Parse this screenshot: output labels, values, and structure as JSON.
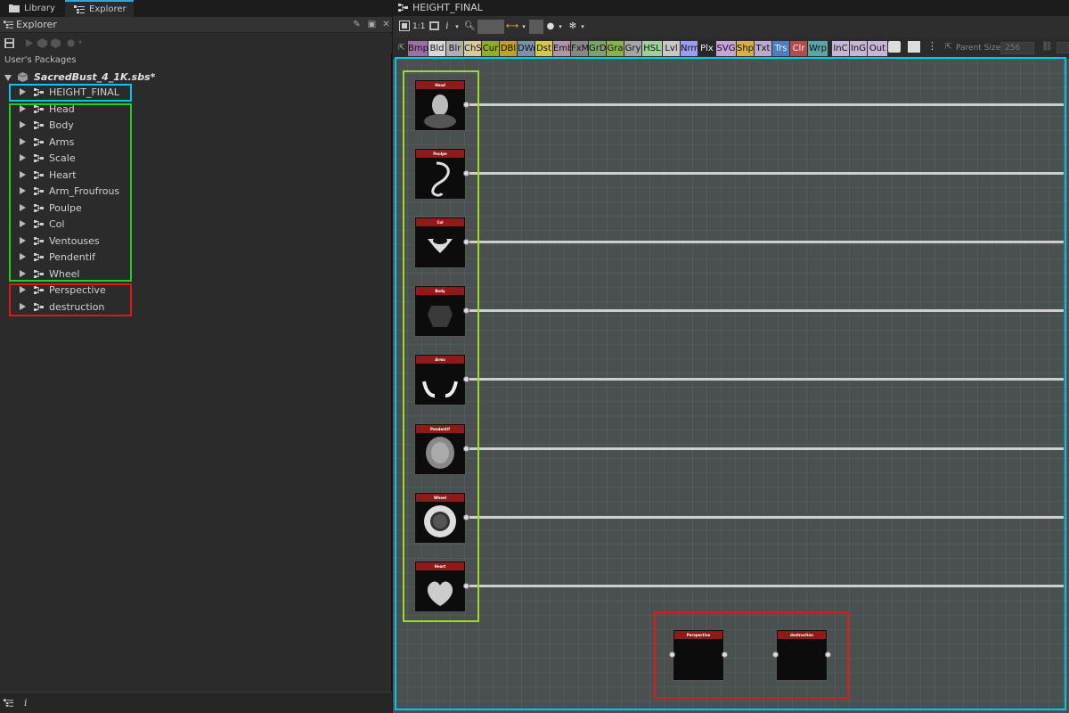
{
  "tabs": [
    {
      "label": "Library"
    },
    {
      "label": "Explorer"
    }
  ],
  "explorer": {
    "title": "Explorer",
    "section_label": "User's Packages",
    "package": "SacredBust_4_1K.sbs*",
    "graphs": [
      {
        "label": "HEIGHT_FINAL"
      },
      {
        "label": "Head"
      },
      {
        "label": "Body"
      },
      {
        "label": "Arms"
      },
      {
        "label": "Scale"
      },
      {
        "label": "Heart"
      },
      {
        "label": "Arm_Froufrous"
      },
      {
        "label": "Poulpe"
      },
      {
        "label": "Col"
      },
      {
        "label": "Ventouses"
      },
      {
        "label": "Pendentif"
      },
      {
        "label": "Wheel"
      },
      {
        "label": "Perspective"
      },
      {
        "label": "destruction"
      }
    ],
    "footer_info": "i"
  },
  "graph_view": {
    "title": "HEIGHT_FINAL",
    "zoom_label": "1:1",
    "info_label": "i",
    "node_buttons": [
      {
        "label": "Bmp",
        "color": "#9c6fa6"
      },
      {
        "label": "Bld",
        "color": "#d9d9d9"
      },
      {
        "label": "Blr",
        "color": "#b0b0b0"
      },
      {
        "label": "ChS",
        "color": "#d7c9a0"
      },
      {
        "label": "Cur",
        "color": "#8fae2a"
      },
      {
        "label": "DBl",
        "color": "#c1a12b"
      },
      {
        "label": "DWr",
        "color": "#7893a9"
      },
      {
        "label": "Dst",
        "color": "#d4c84a"
      },
      {
        "label": "Emb",
        "color": "#b295a9"
      },
      {
        "label": "FxM",
        "color": "#878787"
      },
      {
        "label": "GrD",
        "color": "#7da26a"
      },
      {
        "label": "Gra",
        "color": "#8ab24a"
      },
      {
        "label": "Gry",
        "color": "#a6a6a6"
      },
      {
        "label": "HSL",
        "color": "#9fcf9f"
      },
      {
        "label": "Lvl",
        "color": "#c8c8c8"
      },
      {
        "label": "Nrm",
        "color": "#9b9cf2"
      },
      {
        "label": "Plx",
        "color": "#272727"
      },
      {
        "label": "SVG",
        "color": "#c7a4d7"
      },
      {
        "label": "Shp",
        "color": "#d8b04a"
      },
      {
        "label": "Txt",
        "color": "#bca9d0"
      },
      {
        "label": "Trs",
        "color": "#4a7fc1"
      },
      {
        "label": "Clr",
        "color": "#b54a4a"
      },
      {
        "label": "Wrp",
        "color": "#5aa6a6"
      },
      {
        "label": "InC",
        "color": "#c6b6d6"
      },
      {
        "label": "InG",
        "color": "#c6b6d6"
      },
      {
        "label": "Out",
        "color": "#c6b6d6"
      }
    ],
    "parent_size_label": "Parent Size:",
    "parent_size_value": "256",
    "nodes": [
      {
        "label": "Head"
      },
      {
        "label": "Poulpe"
      },
      {
        "label": "Col"
      },
      {
        "label": "Body"
      },
      {
        "label": "Arms"
      },
      {
        "label": "Pendentif"
      },
      {
        "label": "Wheel"
      },
      {
        "label": "Heart"
      },
      {
        "label": "Perspective"
      },
      {
        "label": "destruction"
      }
    ]
  },
  "highlight_colors": {
    "main": "#00c8e8",
    "components": "#22cc22",
    "components_graph": "#99dd22",
    "unused": "#e01818"
  }
}
